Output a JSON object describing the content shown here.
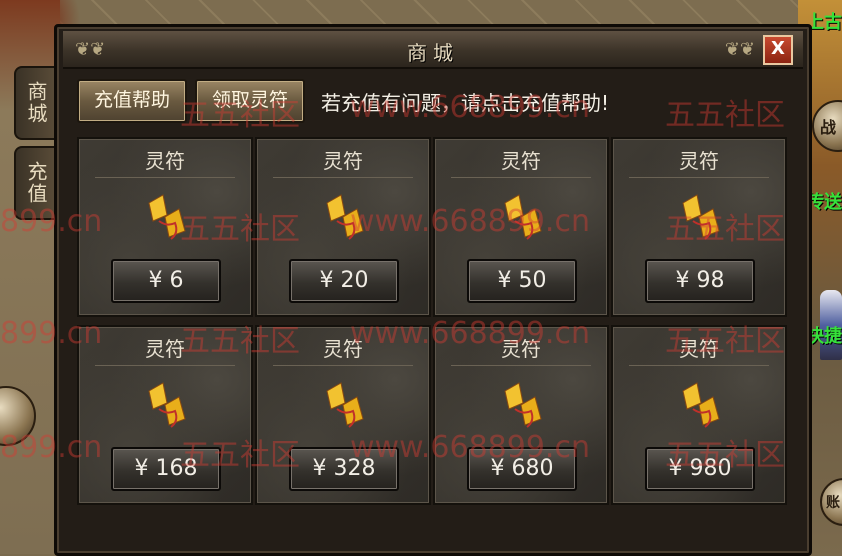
{
  "side_labels": {
    "top": "上古",
    "middle": "传送",
    "lower": "快捷"
  },
  "side_buttons": {
    "right_top_icon": "战",
    "right_bottom_icon": "账"
  },
  "tabs": [
    {
      "label": "商城"
    },
    {
      "label": "充值"
    }
  ],
  "window": {
    "title": "商城",
    "close_label": "X"
  },
  "toolbar": {
    "help_label": "充值帮助",
    "claim_label": "领取灵符",
    "notice": "若充值有问题，请点击充值帮助!"
  },
  "products": [
    {
      "name": "灵符",
      "price": "¥ 6",
      "icon": "talisman-icon"
    },
    {
      "name": "灵符",
      "price": "¥ 20",
      "icon": "talisman-icon"
    },
    {
      "name": "灵符",
      "price": "¥ 50",
      "icon": "talisman-icon"
    },
    {
      "name": "灵符",
      "price": "¥ 98",
      "icon": "talisman-icon"
    },
    {
      "name": "灵符",
      "price": "¥ 168",
      "icon": "talisman-icon"
    },
    {
      "name": "灵符",
      "price": "¥ 328",
      "icon": "talisman-icon"
    },
    {
      "name": "灵符",
      "price": "¥ 680",
      "icon": "talisman-icon"
    },
    {
      "name": "灵符",
      "price": "¥ 980",
      "icon": "talisman-icon"
    }
  ],
  "watermarks": {
    "brand": "五五社区",
    "url": "www.668899.cn",
    "short": "899.cn"
  },
  "colors": {
    "accent_green": "#36e23a",
    "watermark_red": "#d23c32",
    "close_red": "#c84a30"
  }
}
